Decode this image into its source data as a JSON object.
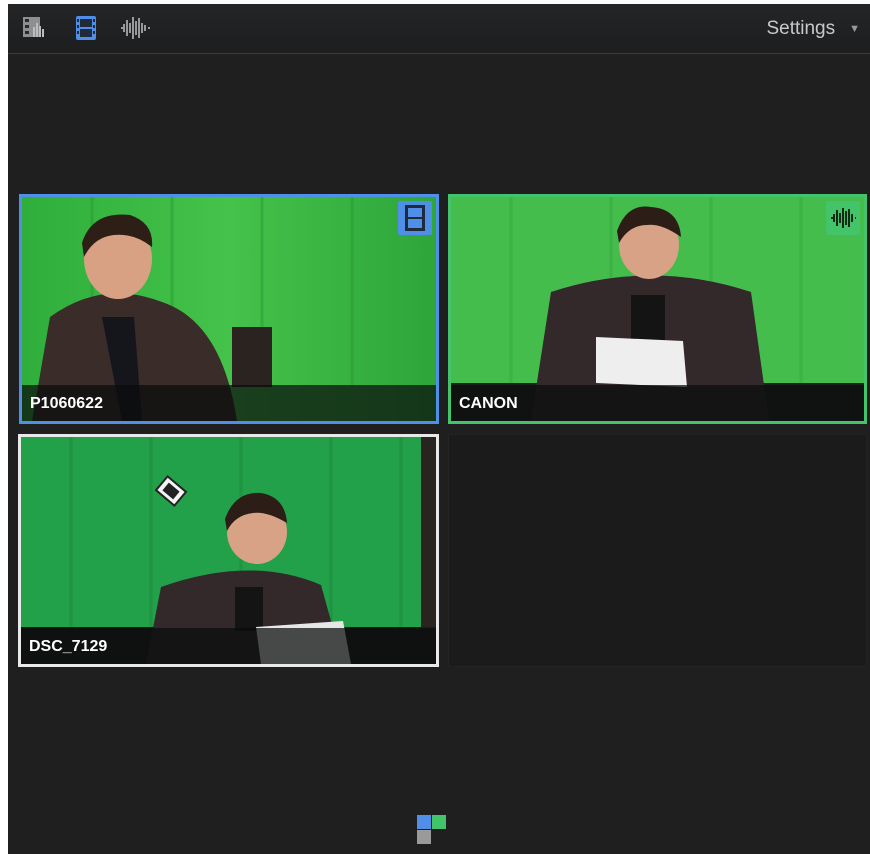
{
  "toolbar": {
    "icons": [
      "video-audio-icon",
      "video-only-icon",
      "audio-only-icon"
    ],
    "settings_label": "Settings",
    "settings_caret": "▼"
  },
  "angles": [
    {
      "label": "P1060622",
      "badge": "filmstrip-icon",
      "state": "video",
      "color": "#4f8fe8"
    },
    {
      "label": "CANON",
      "badge": "waveform-icon",
      "state": "audio",
      "color": "#43c36a"
    },
    {
      "label": "DSC_7129",
      "state": "selected",
      "color": "#e9e9e9"
    }
  ],
  "footer": {
    "icon": "angle-grid-icon",
    "colors": [
      "#4f8fe8",
      "#43c36a",
      "#9a9a9a"
    ]
  }
}
